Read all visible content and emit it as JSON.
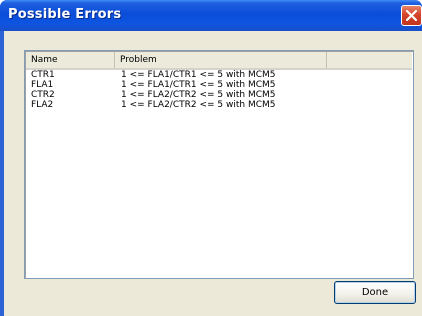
{
  "window": {
    "title": "Possible Errors",
    "close_icon": "close-x-icon"
  },
  "table": {
    "columns": [
      "Name",
      "Problem",
      ""
    ],
    "rows": [
      {
        "name": "CTR1",
        "problem": "1 <= FLA1/CTR1 <= 5 with MCM5"
      },
      {
        "name": "FLA1",
        "problem": "1 <= FLA1/CTR1 <= 5 with MCM5"
      },
      {
        "name": "CTR2",
        "problem": "1 <= FLA2/CTR2 <= 5 with MCM5"
      },
      {
        "name": "FLA2",
        "problem": "1 <= FLA2/CTR2 <= 5 with MCM5"
      }
    ]
  },
  "buttons": {
    "done_label": "Done"
  },
  "colors": {
    "titlebar": "#0a4dd8",
    "close_button": "#d4442a",
    "dialog_background": "#ece9d8",
    "list_border": "#7f9db9"
  }
}
